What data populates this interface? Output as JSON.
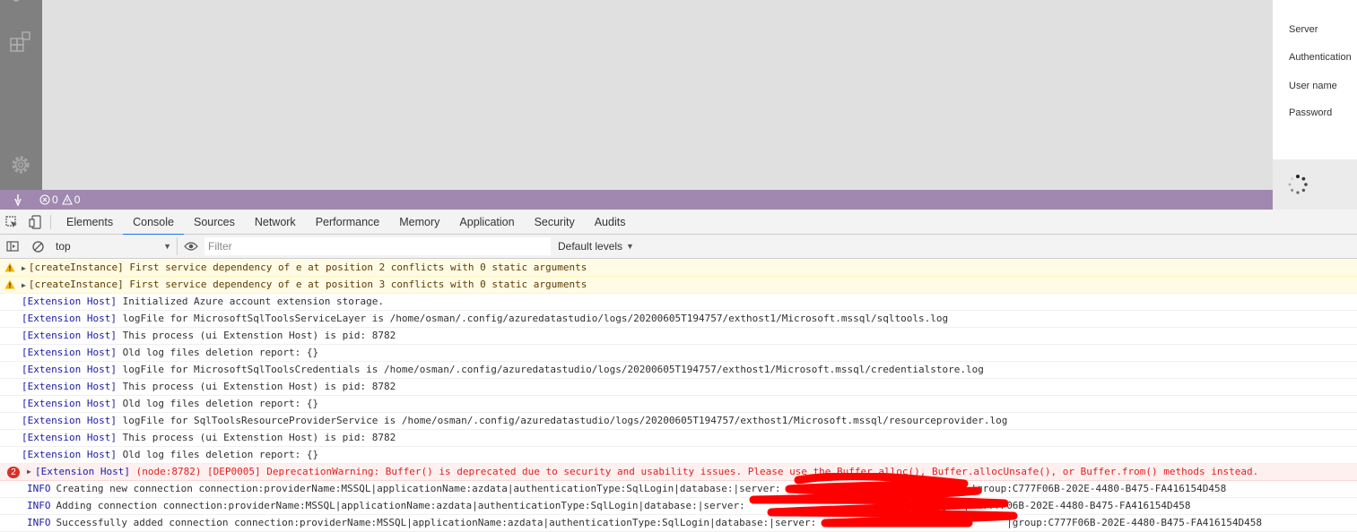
{
  "status_bar": {
    "errors_count": "0",
    "warnings_count": "0"
  },
  "connection_panel": {
    "server_label": "Server",
    "authentication_label": "Authentication",
    "username_label": "User name",
    "password_label": "Password"
  },
  "devtools": {
    "tabs": [
      {
        "label": "Elements"
      },
      {
        "label": "Console"
      },
      {
        "label": "Sources"
      },
      {
        "label": "Network"
      },
      {
        "label": "Performance"
      },
      {
        "label": "Memory"
      },
      {
        "label": "Application"
      },
      {
        "label": "Security"
      },
      {
        "label": "Audits"
      }
    ],
    "active_tab": "Console"
  },
  "console_toolbar": {
    "context": "top",
    "filter_placeholder": "Filter",
    "levels": "Default levels"
  },
  "messages": [
    {
      "type": "warning",
      "source": "[createInstance]",
      "text": " First service dependency of e at position 2 conflicts with 0 static arguments"
    },
    {
      "type": "warning",
      "source": "[createInstance]",
      "text": " First service dependency of e at position 3 conflicts with 0 static arguments"
    },
    {
      "type": "log",
      "source": "[Extension Host]",
      "text": " Initialized Azure account extension storage."
    },
    {
      "type": "log",
      "source": "[Extension Host]",
      "text": " logFile for MicrosoftSqlToolsServiceLayer is /home/osman/.config/azuredatastudio/logs/20200605T194757/exthost1/Microsoft.mssql/sqltools.log"
    },
    {
      "type": "log",
      "source": "[Extension Host]",
      "text": " This process (ui Extenstion Host) is pid: 8782"
    },
    {
      "type": "log",
      "source": "[Extension Host]",
      "text": " Old log files deletion report: {}"
    },
    {
      "type": "log",
      "source": "[Extension Host]",
      "text": " logFile for MicrosoftSqlToolsCredentials is /home/osman/.config/azuredatastudio/logs/20200605T194757/exthost1/Microsoft.mssql/credentialstore.log"
    },
    {
      "type": "log",
      "source": "[Extension Host]",
      "text": " This process (ui Extenstion Host) is pid: 8782"
    },
    {
      "type": "log",
      "source": "[Extension Host]",
      "text": " Old log files deletion report: {}"
    },
    {
      "type": "log",
      "source": "[Extension Host]",
      "text": " logFile for SqlToolsResourceProviderService is /home/osman/.config/azuredatastudio/logs/20200605T194757/exthost1/Microsoft.mssql/resourceprovider.log"
    },
    {
      "type": "log",
      "source": "[Extension Host]",
      "text": " This process (ui Extenstion Host) is pid: 8782"
    },
    {
      "type": "log",
      "source": "[Extension Host]",
      "text": " Old log files deletion report: {}"
    },
    {
      "type": "error",
      "count": "2",
      "source": "[Extension Host]",
      "text": " (node:8782) [DEP0005] DeprecationWarning: Buffer() is deprecated due to security and usability issues. Please use the Buffer.alloc(), Buffer.allocUnsafe(), or Buffer.from() methods instead."
    },
    {
      "type": "info",
      "level": "INFO",
      "text": "Creating new connection connection:providerName:MSSQL|applicationName:azdata|authenticationType:SqlLogin|database:|server:",
      "tail": "|group:C777F06B-202E-4480-B475-FA416154D458"
    },
    {
      "type": "info",
      "level": "INFO",
      "text": "Adding connection connection:providerName:MSSQL|applicationName:azdata|authenticationType:SqlLogin|database:|server:",
      "tail": "|group:C777F06B-202E-4480-B475-FA416154D458"
    },
    {
      "type": "info",
      "level": "INFO",
      "text": "Successfully added connection connection:providerName:MSSQL|applicationName:azdata|authenticationType:SqlLogin|database:|server:",
      "tail": "|group:C777F06B-202E-4480-B475-FA416154D458"
    }
  ]
}
